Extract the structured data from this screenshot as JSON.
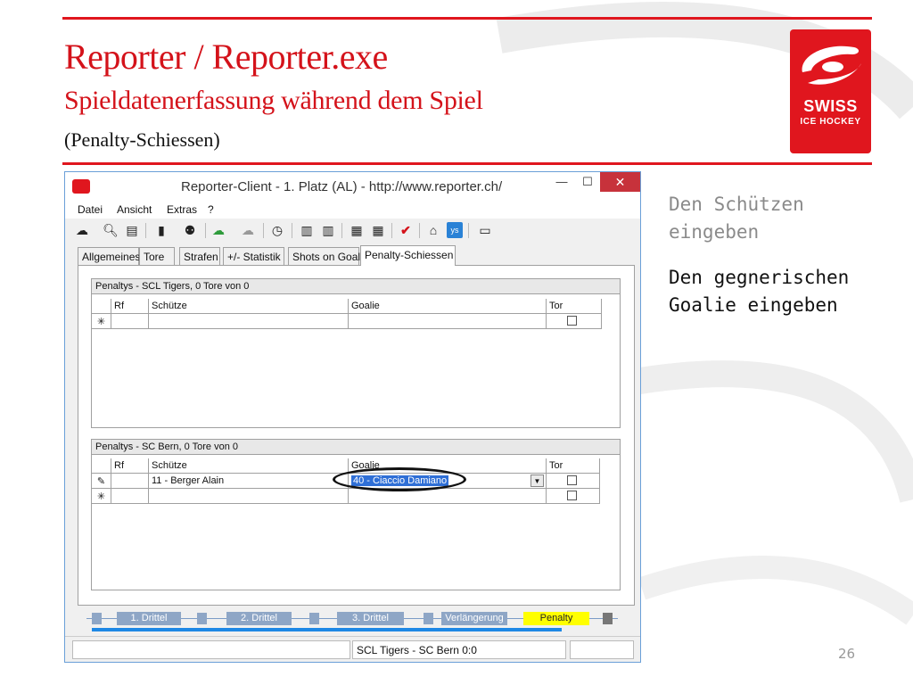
{
  "slide": {
    "title": "Reporter / Reporter.exe",
    "subtitle": "Spieldatenerfassung während dem Spiel",
    "subnote": "(Penalty-Schiessen)",
    "page_number": "26",
    "accent_color": "#e0161e"
  },
  "logo": {
    "line1": "SWISS",
    "line2": "ICE HOCKEY"
  },
  "notes": {
    "note1": "Den Schützen eingeben",
    "note2": "Den gegnerischen Goalie eingeben"
  },
  "window": {
    "title": "Reporter-Client  -  1. Platz (AL)  -  http://www.reporter.ch/",
    "minimize": "—",
    "maximize": "☐",
    "close": "✕"
  },
  "menu": [
    "Datei",
    "Ansicht",
    "Extras",
    "?"
  ],
  "toolbar_icons": [
    "upload-cloud-icon",
    "search-icon",
    "save-icon",
    "clipboard-icon",
    "players-icon",
    "cloud-up-icon",
    "cloud-x-icon",
    "stopwatch-icon",
    "team-home-icon",
    "team-guest-icon",
    "team-swap-icon",
    "team-list-icon",
    "checkmark-icon",
    "house-icon",
    "ys-icon",
    "tv-icon"
  ],
  "tabs": [
    "Allgemeines",
    "Tore",
    "Strafen",
    "+/- Statistik",
    "Shots on Goal",
    "Penalty-Schiessen"
  ],
  "active_tab": "Penalty-Schiessen",
  "grid1": {
    "caption": "Penaltys - SCL Tigers, 0 Tore von 0",
    "columns": [
      "",
      "Rf",
      "Schütze",
      "Goalie",
      "Tor"
    ],
    "new_row_marker": "✳"
  },
  "grid2": {
    "caption": "Penaltys - SC Bern, 0 Tore von 0",
    "columns": [
      "",
      "Rf",
      "Schütze",
      "Goalie",
      "Tor"
    ],
    "rows": [
      {
        "marker": "✎",
        "rf": "",
        "schuetze": "11 - Berger Alain",
        "goalie": "40 - Ciaccio Damiano",
        "tor": false
      }
    ],
    "new_row_marker": "✳"
  },
  "timeline": {
    "periods": [
      "1. Drittel",
      "2. Drittel",
      "3. Drittel",
      "Verlängerung",
      "Penalty"
    ],
    "active": "Penalty"
  },
  "status": {
    "score": "SCL Tigers - SC Bern 0:0"
  }
}
